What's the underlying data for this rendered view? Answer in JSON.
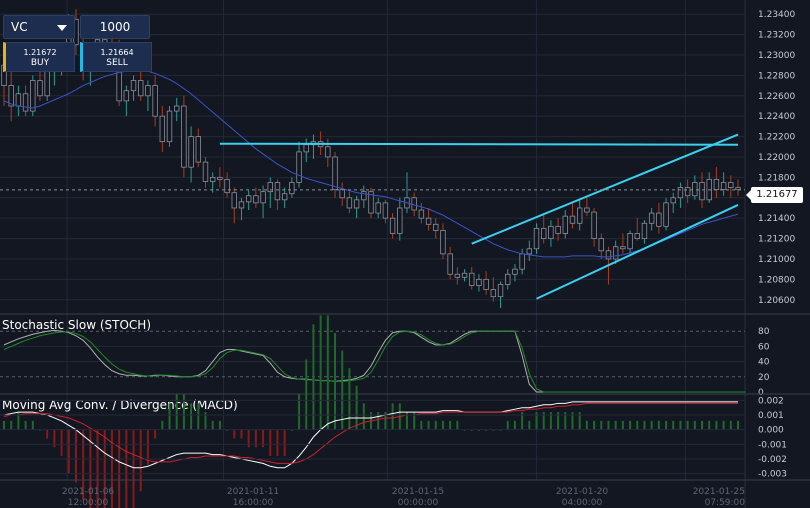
{
  "colors": {
    "background": "#131722",
    "grid": "#232838",
    "candle_bull": "#2a9d8f",
    "candle_bear": "#a8401a",
    "candle_neutral": "#8c8f99",
    "moving_average": "#3a55c8",
    "trendline": "#3ad0ef",
    "stoch_k": "#b0b0b0",
    "stoch_d": "#1f8a2a",
    "macd_line": "#ffffff",
    "signal_line": "#d0202a",
    "hist_pos": "#1e6a2a",
    "hist_neg": "#8a1a1a"
  },
  "order_panel": {
    "symbol": "VC",
    "quantity": "1000",
    "buy_price": "1.21672",
    "buy_label": "BUY",
    "sell_price": "1.21664",
    "sell_label": "SELL"
  },
  "current_price": "1.21677",
  "price_axis": {
    "labels": [
      "1.23400",
      "1.23200",
      "1.23000",
      "1.22800",
      "1.22600",
      "1.22400",
      "1.22200",
      "1.22000",
      "1.21800",
      "1.21600",
      "1.21400",
      "1.21200",
      "1.21000",
      "1.20800",
      "1.20600"
    ],
    "values": [
      1.234,
      1.232,
      1.23,
      1.228,
      1.226,
      1.224,
      1.222,
      1.22,
      1.218,
      1.216,
      1.214,
      1.212,
      1.21,
      1.208,
      1.206
    ]
  },
  "stoch_panel": {
    "title": "Stochastic Slow (STOCH)",
    "labels": [
      "80",
      "60",
      "40",
      "20",
      "0"
    ],
    "values": [
      80,
      60,
      40,
      20,
      0
    ]
  },
  "macd_panel": {
    "title": "Moving Avg Conv. / Divergence (MACD)",
    "labels": [
      "0.002",
      "0.001",
      "0.000",
      "-0.001",
      "-0.002",
      "-0.003"
    ],
    "values": [
      0.002,
      0.001,
      0.0,
      -0.001,
      -0.002,
      -0.003
    ]
  },
  "time_axis": [
    {
      "date": "2021-01-06",
      "time": "12:00:00"
    },
    {
      "date": "2021-01-11",
      "time": "16:00:00"
    },
    {
      "date": "2021-01-15",
      "time": "00:00:00"
    },
    {
      "date": "2021-01-20",
      "time": "04:00:00"
    },
    {
      "date": "2021-01-25",
      "time": "07:59:00"
    }
  ],
  "chart_data": {
    "type": "candlestick",
    "xlabel": "",
    "ylabel": "",
    "ylim": [
      1.2048,
      1.235
    ],
    "candles": [
      [
        1.229,
        1.231,
        1.225,
        1.227
      ],
      [
        1.227,
        1.2285,
        1.2235,
        1.225
      ],
      [
        1.225,
        1.227,
        1.224,
        1.2262
      ],
      [
        1.2262,
        1.227,
        1.224,
        1.2245
      ],
      [
        1.2245,
        1.228,
        1.224,
        1.2275
      ],
      [
        1.2275,
        1.2292,
        1.2255,
        1.226
      ],
      [
        1.226,
        1.229,
        1.2255,
        1.2285
      ],
      [
        1.2285,
        1.23,
        1.227,
        1.229
      ],
      [
        1.229,
        1.231,
        1.228,
        1.23
      ],
      [
        1.23,
        1.234,
        1.229,
        1.2335
      ],
      [
        1.2335,
        1.2345,
        1.23,
        1.231
      ],
      [
        1.231,
        1.2325,
        1.2275,
        1.229
      ],
      [
        1.229,
        1.2305,
        1.227,
        1.23
      ],
      [
        1.23,
        1.232,
        1.229,
        1.2315
      ],
      [
        1.2315,
        1.233,
        1.2295,
        1.231
      ],
      [
        1.231,
        1.232,
        1.2295,
        1.2305
      ],
      [
        1.2305,
        1.2315,
        1.225,
        1.2255
      ],
      [
        1.2255,
        1.227,
        1.224,
        1.2265
      ],
      [
        1.2265,
        1.228,
        1.2255,
        1.2275
      ],
      [
        1.2275,
        1.2285,
        1.2255,
        1.226
      ],
      [
        1.226,
        1.2275,
        1.2245,
        1.227
      ],
      [
        1.227,
        1.228,
        1.223,
        1.224
      ],
      [
        1.224,
        1.225,
        1.2205,
        1.2215
      ],
      [
        1.2215,
        1.225,
        1.221,
        1.2245
      ],
      [
        1.2245,
        1.2258,
        1.2235,
        1.225
      ],
      [
        1.225,
        1.226,
        1.218,
        1.219
      ],
      [
        1.219,
        1.223,
        1.2175,
        1.222
      ],
      [
        1.222,
        1.2228,
        1.219,
        1.2195
      ],
      [
        1.2195,
        1.22,
        1.217,
        1.2176
      ],
      [
        1.2176,
        1.2185,
        1.2165,
        1.218
      ],
      [
        1.218,
        1.219,
        1.217,
        1.2178
      ],
      [
        1.2178,
        1.2185,
        1.216,
        1.2165
      ],
      [
        1.2165,
        1.217,
        1.2135,
        1.215
      ],
      [
        1.215,
        1.216,
        1.2138,
        1.2156
      ],
      [
        1.2156,
        1.2168,
        1.2148,
        1.2162
      ],
      [
        1.2162,
        1.217,
        1.215,
        1.2155
      ],
      [
        1.2155,
        1.2172,
        1.214,
        1.2166
      ],
      [
        1.2166,
        1.218,
        1.215,
        1.2175
      ],
      [
        1.2175,
        1.2178,
        1.2148,
        1.2158
      ],
      [
        1.2158,
        1.217,
        1.215,
        1.2164
      ],
      [
        1.2164,
        1.218,
        1.216,
        1.2175
      ],
      [
        1.2175,
        1.2215,
        1.217,
        1.2205
      ],
      [
        1.2205,
        1.2218,
        1.2195,
        1.2212
      ],
      [
        1.2212,
        1.2222,
        1.2198,
        1.2215
      ],
      [
        1.2215,
        1.2225,
        1.2202,
        1.221
      ],
      [
        1.221,
        1.2218,
        1.219,
        1.22
      ],
      [
        1.22,
        1.2205,
        1.216,
        1.2168
      ],
      [
        1.2168,
        1.2175,
        1.2152,
        1.216
      ],
      [
        1.216,
        1.2166,
        1.2145,
        1.215
      ],
      [
        1.215,
        1.2162,
        1.214,
        1.2158
      ],
      [
        1.2158,
        1.2172,
        1.215,
        1.2166
      ],
      [
        1.2166,
        1.217,
        1.214,
        1.2145
      ],
      [
        1.2145,
        1.216,
        1.214,
        1.2155
      ],
      [
        1.2155,
        1.2158,
        1.2135,
        1.214
      ],
      [
        1.214,
        1.2145,
        1.212,
        1.2125
      ],
      [
        1.2125,
        1.216,
        1.2118,
        1.215
      ],
      [
        1.215,
        1.2185,
        1.2145,
        1.216
      ],
      [
        1.216,
        1.2165,
        1.2142,
        1.2148
      ],
      [
        1.2148,
        1.2155,
        1.2135,
        1.214
      ],
      [
        1.214,
        1.215,
        1.2128,
        1.2134
      ],
      [
        1.2134,
        1.214,
        1.212,
        1.2128
      ],
      [
        1.2128,
        1.2135,
        1.21,
        1.2105
      ],
      [
        1.2105,
        1.2112,
        1.208,
        1.2085
      ],
      [
        1.2085,
        1.2092,
        1.2075,
        1.2082
      ],
      [
        1.2082,
        1.209,
        1.2078,
        1.2086
      ],
      [
        1.2086,
        1.2092,
        1.207,
        1.2074
      ],
      [
        1.2074,
        1.2085,
        1.2068,
        1.208
      ],
      [
        1.208,
        1.2088,
        1.2065,
        1.207
      ],
      [
        1.207,
        1.2082,
        1.2058,
        1.2063
      ],
      [
        1.2063,
        1.2078,
        1.2052,
        1.2075
      ],
      [
        1.2075,
        1.209,
        1.207,
        1.2085
      ],
      [
        1.2085,
        1.2095,
        1.2078,
        1.209
      ],
      [
        1.209,
        1.211,
        1.2085,
        1.2105
      ],
      [
        1.2105,
        1.2118,
        1.2098,
        1.211
      ],
      [
        1.211,
        1.2135,
        1.2105,
        1.213
      ],
      [
        1.213,
        1.2145,
        1.2115,
        1.212
      ],
      [
        1.212,
        1.2138,
        1.2112,
        1.2132
      ],
      [
        1.2132,
        1.214,
        1.2118,
        1.2125
      ],
      [
        1.2125,
        1.2148,
        1.212,
        1.2142
      ],
      [
        1.2142,
        1.2155,
        1.213,
        1.2135
      ],
      [
        1.2135,
        1.2158,
        1.2128,
        1.215
      ],
      [
        1.215,
        1.216,
        1.2142,
        1.2146
      ],
      [
        1.2146,
        1.215,
        1.2112,
        1.212
      ],
      [
        1.212,
        1.2125,
        1.21,
        1.2108
      ],
      [
        1.2108,
        1.2112,
        1.2075,
        1.21
      ],
      [
        1.21,
        1.2118,
        1.2095,
        1.2112
      ],
      [
        1.2112,
        1.2125,
        1.2105,
        1.211
      ],
      [
        1.211,
        1.2128,
        1.2105,
        1.2125
      ],
      [
        1.2125,
        1.214,
        1.2118,
        1.212
      ],
      [
        1.212,
        1.2138,
        1.2115,
        1.2135
      ],
      [
        1.2135,
        1.215,
        1.2128,
        1.2145
      ],
      [
        1.2145,
        1.2155,
        1.2125,
        1.2132
      ],
      [
        1.2132,
        1.216,
        1.2128,
        1.2155
      ],
      [
        1.2155,
        1.2165,
        1.2145,
        1.216
      ],
      [
        1.216,
        1.2175,
        1.215,
        1.217
      ],
      [
        1.217,
        1.2178,
        1.2155,
        1.2162
      ],
      [
        1.2162,
        1.2182,
        1.2158,
        1.2175
      ],
      [
        1.2175,
        1.2185,
        1.215,
        1.2158
      ],
      [
        1.2158,
        1.2185,
        1.2155,
        1.2178
      ],
      [
        1.2178,
        1.219,
        1.216,
        1.2168
      ],
      [
        1.2168,
        1.2185,
        1.2162,
        1.2175
      ],
      [
        1.2175,
        1.2182,
        1.216,
        1.217
      ],
      [
        1.217,
        1.2178,
        1.2162,
        1.2168
      ]
    ],
    "moving_average": [
      1.2255,
      1.2252,
      1.225,
      1.2249,
      1.2248,
      1.225,
      1.2253,
      1.2256,
      1.2259,
      1.2262,
      1.2266,
      1.227,
      1.2273,
      1.2276,
      1.2279,
      1.2281,
      1.2283,
      1.2284,
      1.2285,
      1.2285,
      1.2284,
      1.2282,
      1.2279,
      1.2276,
      1.2272,
      1.2267,
      1.2262,
      1.2256,
      1.225,
      1.2244,
      1.2238,
      1.2232,
      1.2226,
      1.222,
      1.2214,
      1.2208,
      1.2203,
      1.2198,
      1.2193,
      1.2189,
      1.2185,
      1.2182,
      1.2179,
      1.2177,
      1.2175,
      1.2173,
      1.2171,
      1.2169,
      1.2167,
      1.2165,
      1.2164,
      1.2163,
      1.2162,
      1.2161,
      1.2159,
      1.2157,
      1.2155,
      1.2153,
      1.2151,
      1.2149,
      1.2146,
      1.2143,
      1.2139,
      1.2135,
      1.2131,
      1.2127,
      1.2123,
      1.2119,
      1.2115,
      1.2112,
      1.2109,
      1.2107,
      1.2105,
      1.2104,
      1.2103,
      1.2102,
      1.2102,
      1.2102,
      1.2102,
      1.2103,
      1.2103,
      1.2103,
      1.2103,
      1.2102,
      1.2102,
      1.2103,
      1.2104,
      1.2106,
      1.2108,
      1.211,
      1.2113,
      1.2116,
      1.2119,
      1.2122,
      1.2125,
      1.2128,
      1.2131,
      1.2134,
      1.2136,
      1.2138,
      1.214,
      1.2142,
      1.2144
    ],
    "trendlines": [
      {
        "from": [
          30,
          1.2213
        ],
        "to": [
          102,
          1.2212
        ]
      },
      {
        "from": [
          65,
          1.2115
        ],
        "to": [
          102,
          1.2222
        ]
      },
      {
        "from": [
          74,
          1.2061
        ],
        "to": [
          102,
          1.2153
        ]
      }
    ],
    "stoch_k": [
      62,
      66,
      70,
      73,
      76,
      78,
      80,
      81,
      80,
      78,
      74,
      68,
      58,
      46,
      36,
      28,
      24,
      22,
      22,
      21,
      21,
      22,
      22,
      21,
      20,
      20,
      20,
      22,
      28,
      40,
      52,
      56,
      56,
      54,
      52,
      50,
      48,
      38,
      26,
      20,
      18,
      17,
      17,
      16,
      15,
      15,
      14,
      15,
      16,
      18,
      22,
      34,
      52,
      68,
      78,
      80,
      80,
      78,
      72,
      66,
      62,
      62,
      64,
      70,
      76,
      80,
      80,
      80,
      80,
      80,
      80,
      80,
      48,
      10,
      0,
      0,
      0,
      0,
      0,
      0,
      0,
      0,
      0,
      0,
      0,
      0,
      0,
      0,
      0,
      0,
      0,
      0,
      0,
      0,
      0,
      0,
      0,
      0,
      0,
      0,
      0,
      0,
      0,
      0
    ],
    "stoch_d": [
      56,
      60,
      64,
      68,
      71,
      74,
      76,
      78,
      79,
      79,
      77,
      73,
      66,
      56,
      46,
      37,
      30,
      26,
      24,
      22,
      21,
      21,
      22,
      22,
      21,
      20,
      20,
      21,
      24,
      32,
      44,
      52,
      55,
      55,
      53,
      51,
      49,
      44,
      34,
      24,
      19,
      17,
      16,
      16,
      15,
      15,
      14,
      14,
      15,
      16,
      18,
      26,
      42,
      60,
      73,
      79,
      80,
      79,
      75,
      69,
      64,
      62,
      63,
      67,
      73,
      78,
      80,
      80,
      80,
      80,
      80,
      80,
      58,
      24,
      4,
      0,
      0,
      0,
      0,
      0,
      0,
      0,
      0,
      0,
      0,
      0,
      0,
      0,
      0,
      0,
      0,
      0,
      0,
      0,
      0,
      0,
      0,
      0,
      0,
      0,
      0,
      0,
      0,
      0
    ],
    "macd": [
      0.001,
      0.0011,
      0.0012,
      0.0012,
      0.0012,
      0.0011,
      0.001,
      0.0008,
      0.0006,
      0.0003,
      0.0,
      -0.0004,
      -0.0008,
      -0.0012,
      -0.0016,
      -0.0019,
      -0.0022,
      -0.0024,
      -0.0026,
      -0.0026,
      -0.0025,
      -0.0023,
      -0.0021,
      -0.0019,
      -0.0017,
      -0.0016,
      -0.0016,
      -0.0016,
      -0.0016,
      -0.0017,
      -0.0017,
      -0.0018,
      -0.0019,
      -0.002,
      -0.0021,
      -0.0022,
      -0.0023,
      -0.0025,
      -0.0026,
      -0.0026,
      -0.0023,
      -0.0018,
      -0.0012,
      -0.0005,
      0.0,
      0.0004,
      0.0006,
      0.0007,
      0.0008,
      0.0008,
      0.0008,
      0.0008,
      0.0009,
      0.001,
      0.0011,
      0.0012,
      0.0012,
      0.0012,
      0.0012,
      0.0012,
      0.0012,
      0.0013,
      0.0013,
      0.0013,
      0.0012,
      0.0012,
      0.0012,
      0.0012,
      0.0012,
      0.0012,
      0.0013,
      0.0014,
      0.0015,
      0.0015,
      0.0016,
      0.0017,
      0.0017,
      0.0018,
      0.0018,
      0.0019,
      0.0019,
      0.0019,
      0.0019,
      0.0019,
      0.0019,
      0.0019,
      0.0019,
      0.0019,
      0.0019,
      0.0019,
      0.0019,
      0.0019,
      0.0019,
      0.0019,
      0.0019,
      0.0019,
      0.0019,
      0.0019,
      0.0019,
      0.0019,
      0.0019,
      0.0019,
      0.0019
    ],
    "signal": [
      0.0009,
      0.001,
      0.001,
      0.0011,
      0.0011,
      0.0011,
      0.0011,
      0.001,
      0.0009,
      0.0008,
      0.0006,
      0.0004,
      0.0001,
      -0.0002,
      -0.0005,
      -0.0009,
      -0.0012,
      -0.0015,
      -0.0017,
      -0.0019,
      -0.0021,
      -0.0022,
      -0.0022,
      -0.0022,
      -0.0021,
      -0.002,
      -0.0019,
      -0.0019,
      -0.0018,
      -0.0018,
      -0.0018,
      -0.0018,
      -0.0018,
      -0.0019,
      -0.0019,
      -0.002,
      -0.0021,
      -0.0022,
      -0.0023,
      -0.0023,
      -0.0023,
      -0.0022,
      -0.002,
      -0.0017,
      -0.0013,
      -0.0009,
      -0.0005,
      -0.0002,
      0.0001,
      0.0003,
      0.0005,
      0.0006,
      0.0007,
      0.0008,
      0.0008,
      0.0009,
      0.001,
      0.001,
      0.0011,
      0.0011,
      0.0011,
      0.0012,
      0.0012,
      0.0012,
      0.0012,
      0.0012,
      0.0012,
      0.0012,
      0.0012,
      0.0012,
      0.0012,
      0.0013,
      0.0013,
      0.0014,
      0.0014,
      0.0015,
      0.0015,
      0.0016,
      0.0016,
      0.0017,
      0.0017,
      0.0018,
      0.0018,
      0.0018,
      0.0018,
      0.0018,
      0.0018,
      0.0018,
      0.0018,
      0.0018,
      0.0018,
      0.0018,
      0.0018,
      0.0018,
      0.0018,
      0.0018,
      0.0018,
      0.0018,
      0.0018,
      0.0018,
      0.0018,
      0.0018,
      0.0018
    ]
  }
}
